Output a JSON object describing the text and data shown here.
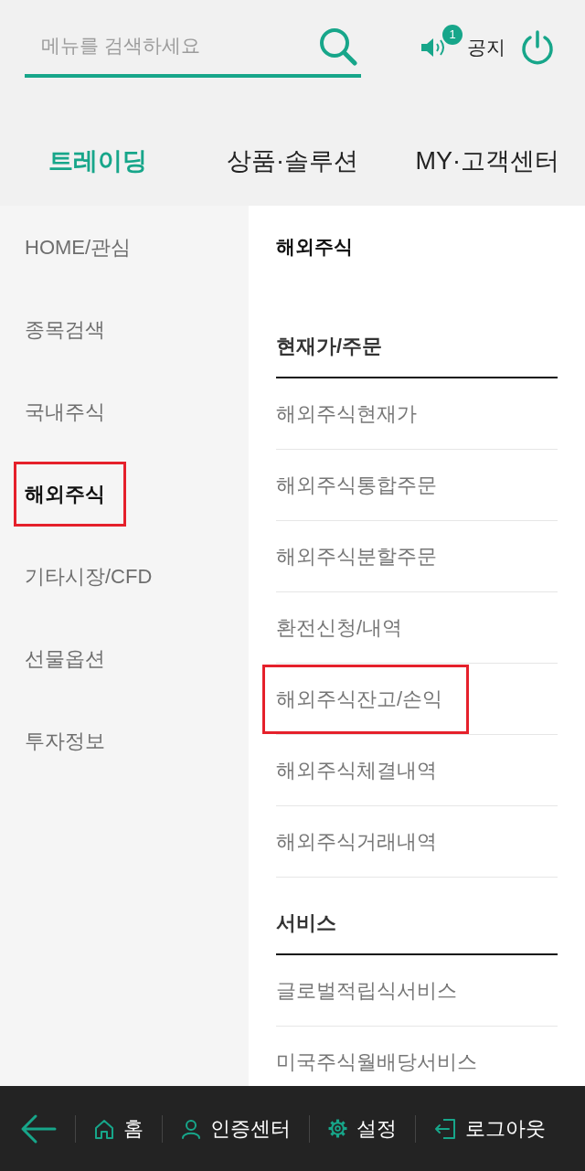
{
  "search": {
    "placeholder": "메뉴를 검색하세요"
  },
  "notice": {
    "label": "공지",
    "count": "1"
  },
  "tabs": [
    {
      "label": "트레이딩",
      "selected": true
    },
    {
      "label": "상품·솔루션",
      "selected": false
    },
    {
      "label": "MY·고객센터",
      "selected": false
    }
  ],
  "sidebar": {
    "items": [
      {
        "label": "HOME/관심",
        "selected": false,
        "highlighted": false
      },
      {
        "label": "종목검색",
        "selected": false,
        "highlighted": false
      },
      {
        "label": "국내주식",
        "selected": false,
        "highlighted": false
      },
      {
        "label": "해외주식",
        "selected": true,
        "highlighted": true
      },
      {
        "label": "기타시장/CFD",
        "selected": false,
        "highlighted": false
      },
      {
        "label": "선물옵션",
        "selected": false,
        "highlighted": false
      },
      {
        "label": "투자정보",
        "selected": false,
        "highlighted": false
      }
    ]
  },
  "content": {
    "title": "해외주식",
    "sections": [
      {
        "heading": "현재가/주문",
        "items": [
          {
            "label": "해외주식현재가",
            "highlighted": false
          },
          {
            "label": "해외주식통합주문",
            "highlighted": false
          },
          {
            "label": "해외주식분할주문",
            "highlighted": false
          },
          {
            "label": "환전신청/내역",
            "highlighted": false
          },
          {
            "label": "해외주식잔고/손익",
            "highlighted": true
          },
          {
            "label": "해외주식체결내역",
            "highlighted": false
          },
          {
            "label": "해외주식거래내역",
            "highlighted": false
          }
        ]
      },
      {
        "heading": "서비스",
        "items": [
          {
            "label": "글로벌적립식서비스",
            "highlighted": false
          },
          {
            "label": "미국주식월배당서비스",
            "highlighted": false
          }
        ]
      }
    ]
  },
  "bottom_bar": {
    "items": [
      {
        "label": "홈"
      },
      {
        "label": "인증센터"
      },
      {
        "label": "설정"
      },
      {
        "label": "로그아웃"
      }
    ]
  }
}
